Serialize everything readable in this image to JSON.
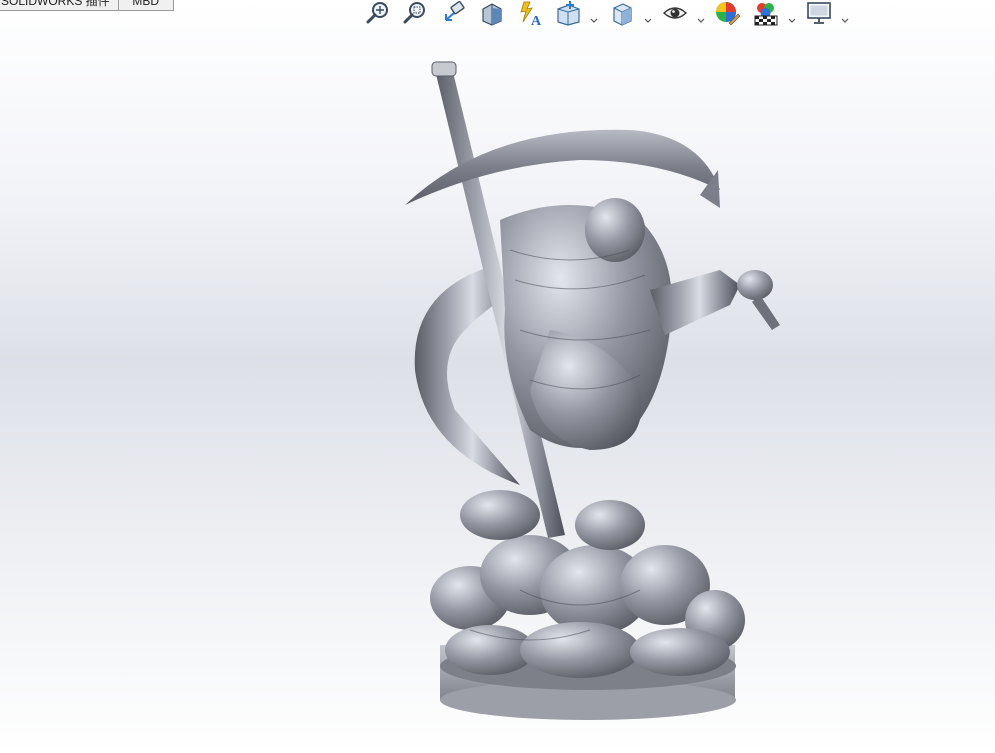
{
  "tabs": [
    {
      "label": "SOLIDWORKS 插件"
    },
    {
      "label": "MBD"
    }
  ],
  "toolbar": {
    "buttons": [
      {
        "name": "zoom-to-fit-icon"
      },
      {
        "name": "zoom-to-area-icon"
      },
      {
        "name": "previous-view-icon"
      },
      {
        "name": "section-view-icon"
      },
      {
        "name": "dynamic-annotation-views-icon"
      },
      {
        "name": "view-orientation-icon"
      },
      {
        "name": "display-style-icon"
      },
      {
        "name": "hide-show-items-icon"
      },
      {
        "name": "edit-appearance-icon"
      },
      {
        "name": "apply-scene-icon"
      },
      {
        "name": "view-settings-icon"
      }
    ]
  },
  "colors": {
    "model": "#8a8c98",
    "model_highlight": "#e4e6ee",
    "model_shadow": "#4c4e58"
  }
}
